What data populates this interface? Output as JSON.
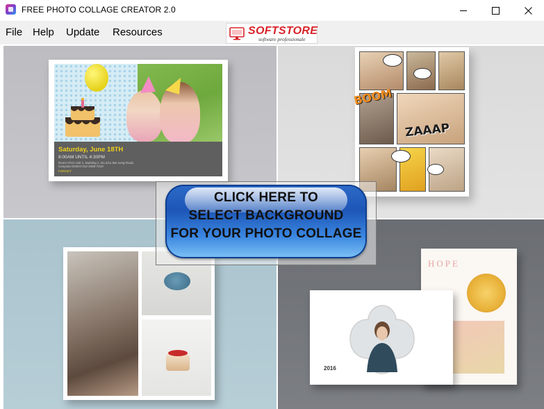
{
  "window": {
    "title": "FREE PHOTO COLLAGE CREATOR 2.0",
    "icons": {
      "app": "app-icon",
      "minimize": "minimize-icon",
      "maximize": "maximize-icon",
      "close": "close-icon"
    }
  },
  "menu": {
    "items": [
      {
        "label": "File"
      },
      {
        "label": "Help"
      },
      {
        "label": "Update"
      },
      {
        "label": "Resources"
      }
    ]
  },
  "logo": {
    "brand": "SOFTSTORE",
    "tagline": "software professionale"
  },
  "cta": {
    "line1": "CLICK HERE TO",
    "line2": "SELECT BACKGROUND",
    "line3": "FOR YOUR PHOTO COLLAGE"
  },
  "templates": {
    "birthday": {
      "date": "Saturday, June 18TH",
      "time": "8:00AM  UNTIL  4:30PM",
      "address": "Room 0721 Unit 1, Building 1, No.4/11 Bei nong Road, Caoyuan District  012-3456-7210",
      "rsvp": "FORGET"
    },
    "comic": {
      "boom": "BOOM",
      "zaaap": "ZAAAP"
    },
    "lookbook": {
      "title": "HOPE",
      "year": "2016"
    }
  },
  "colors": {
    "cta_blue": "#1d56b6",
    "cta_light": "#7ec2f5",
    "birthday_yellow": "#f0d21c",
    "boom_orange": "#f28c1c"
  }
}
